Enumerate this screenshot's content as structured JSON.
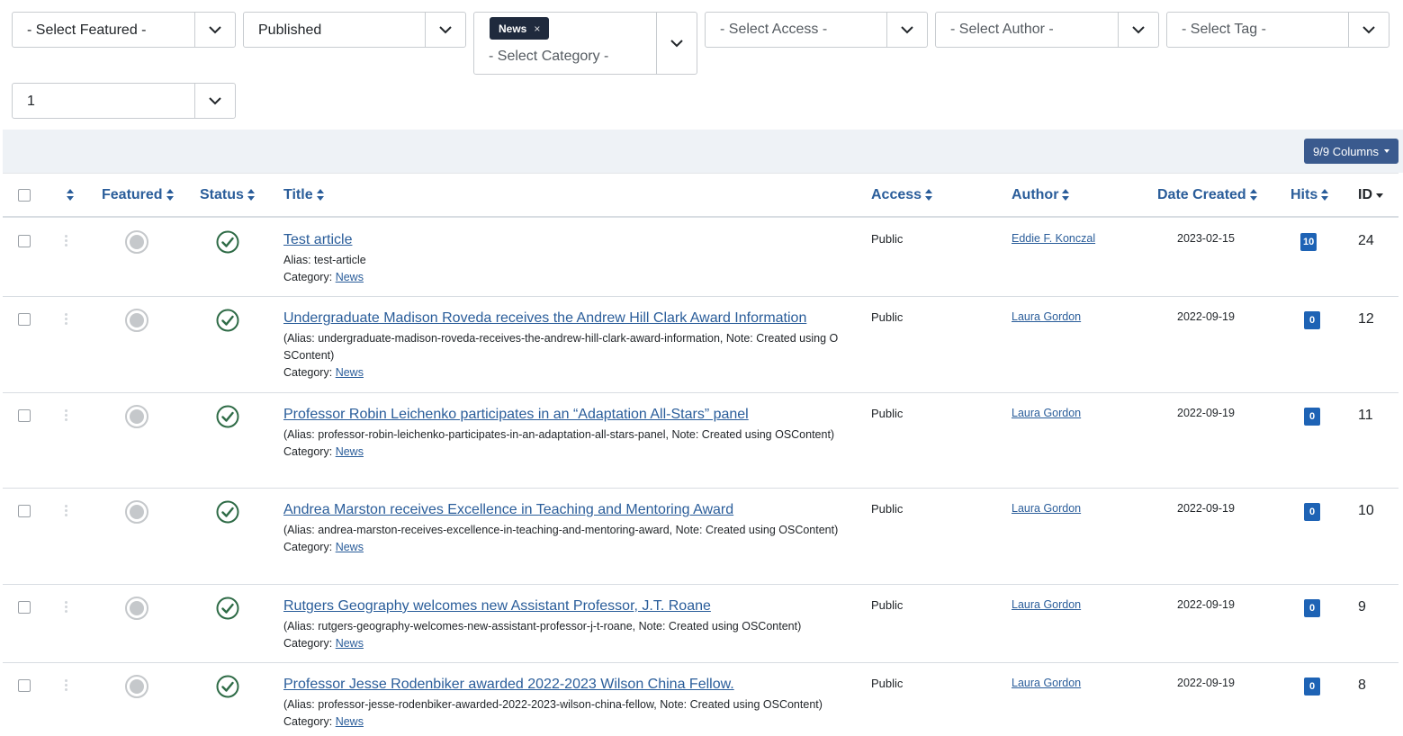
{
  "filters": {
    "featured": "- Select Featured -",
    "published": "Published",
    "category_tag": "News",
    "category_tag_remove": "×",
    "category_placeholder": "- Select Category -",
    "access": "- Select Access -",
    "author": "- Select Author -",
    "tag": "- Select Tag -",
    "level": "1"
  },
  "toolbar": {
    "columns_label": "9/9 Columns"
  },
  "table": {
    "headers": {
      "featured": "Featured",
      "status": "Status",
      "title": "Title",
      "access": "Access",
      "author": "Author",
      "date_created": "Date Created",
      "hits": "Hits",
      "id": "ID"
    },
    "category_label": "Category:",
    "rows": [
      {
        "title": "Test article",
        "alias": "Alias: test-article",
        "category": "News",
        "access": "Public",
        "author": "Eddie F. Konczal",
        "date": "2023-02-15",
        "hits": "10",
        "id": "24"
      },
      {
        "title": "Undergraduate Madison Roveda receives the Andrew Hill Clark Award Information",
        "alias": "(Alias: undergraduate-madison-roveda-receives-the-andrew-hill-clark-award-information, Note: Created using OSContent)",
        "category": "News",
        "access": "Public",
        "author": "Laura Gordon",
        "date": "2022-09-19",
        "hits": "0",
        "id": "12"
      },
      {
        "title": "Professor Robin Leichenko participates in an “Adaptation All-Stars” panel",
        "alias": "(Alias: professor-robin-leichenko-participates-in-an-adaptation-all-stars-panel, Note: Created using OSContent)",
        "category": "News",
        "access": "Public",
        "author": "Laura Gordon",
        "date": "2022-09-19",
        "hits": "0",
        "id": "11"
      },
      {
        "title": "Andrea Marston receives Excellence in Teaching and Mentoring Award",
        "alias": "(Alias: andrea-marston-receives-excellence-in-teaching-and-mentoring-award, Note: Created using OSContent)",
        "category": "News",
        "access": "Public",
        "author": "Laura Gordon",
        "date": "2022-09-19",
        "hits": "0",
        "id": "10"
      },
      {
        "title": "Rutgers Geography welcomes new Assistant Professor, J.T. Roane",
        "alias": "(Alias: rutgers-geography-welcomes-new-assistant-professor-j-t-roane, Note: Created using OSContent)",
        "category": "News",
        "access": "Public",
        "author": "Laura Gordon",
        "date": "2022-09-19",
        "hits": "0",
        "id": "9"
      },
      {
        "title": "Professor Jesse Rodenbiker awarded 2022-2023 Wilson China Fellow.",
        "alias": "(Alias: professor-jesse-rodenbiker-awarded-2022-2023-wilson-china-fellow, Note: Created using OSContent)",
        "category": "News",
        "access": "Public",
        "author": "Laura Gordon",
        "date": "2022-09-19",
        "hits": "0",
        "id": "8"
      }
    ]
  },
  "colors": {
    "link": "#2a5d9a",
    "published_check": "#2e6b46",
    "hits_badge": "#1e63b5",
    "columns_button": "#3a5a8e",
    "tag_background": "#1f2a3d"
  }
}
